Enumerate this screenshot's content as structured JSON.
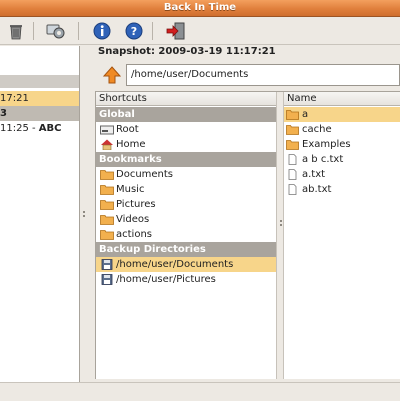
{
  "window": {
    "title": "Back In Time"
  },
  "toolbar": {
    "icons": [
      "trash-icon",
      "settings-gear-icon",
      "info-icon",
      "help-icon",
      "exit-icon"
    ]
  },
  "left_pane": {
    "rows": [
      {
        "time": "17:21",
        "name": ""
      },
      {
        "time": "3",
        "name": ""
      },
      {
        "time": "11:25 - ",
        "name": "ABC"
      }
    ]
  },
  "snapshot": {
    "label": "Snapshot: 2009-03-19 11:17:21",
    "path": "/home/user/Documents"
  },
  "shortcuts": {
    "header": "Shortcuts",
    "groups": {
      "global": "Global",
      "bookmarks": "Bookmarks",
      "backup": "Backup Directories"
    },
    "global_items": [
      "Root",
      "Home"
    ],
    "bookmark_items": [
      "Documents",
      "Music",
      "Pictures",
      "Videos",
      "actions"
    ],
    "backup_items": [
      "/home/user/Documents",
      "/home/user/Pictures"
    ]
  },
  "files": {
    "header": "Name",
    "items": [
      "a",
      "cache",
      "Examples",
      "a b c.txt",
      "a.txt",
      "ab.txt"
    ]
  },
  "colors": {
    "titlebar": "#e07f3c",
    "selection": "#f7d58a",
    "group_header": "#a9a49d"
  }
}
